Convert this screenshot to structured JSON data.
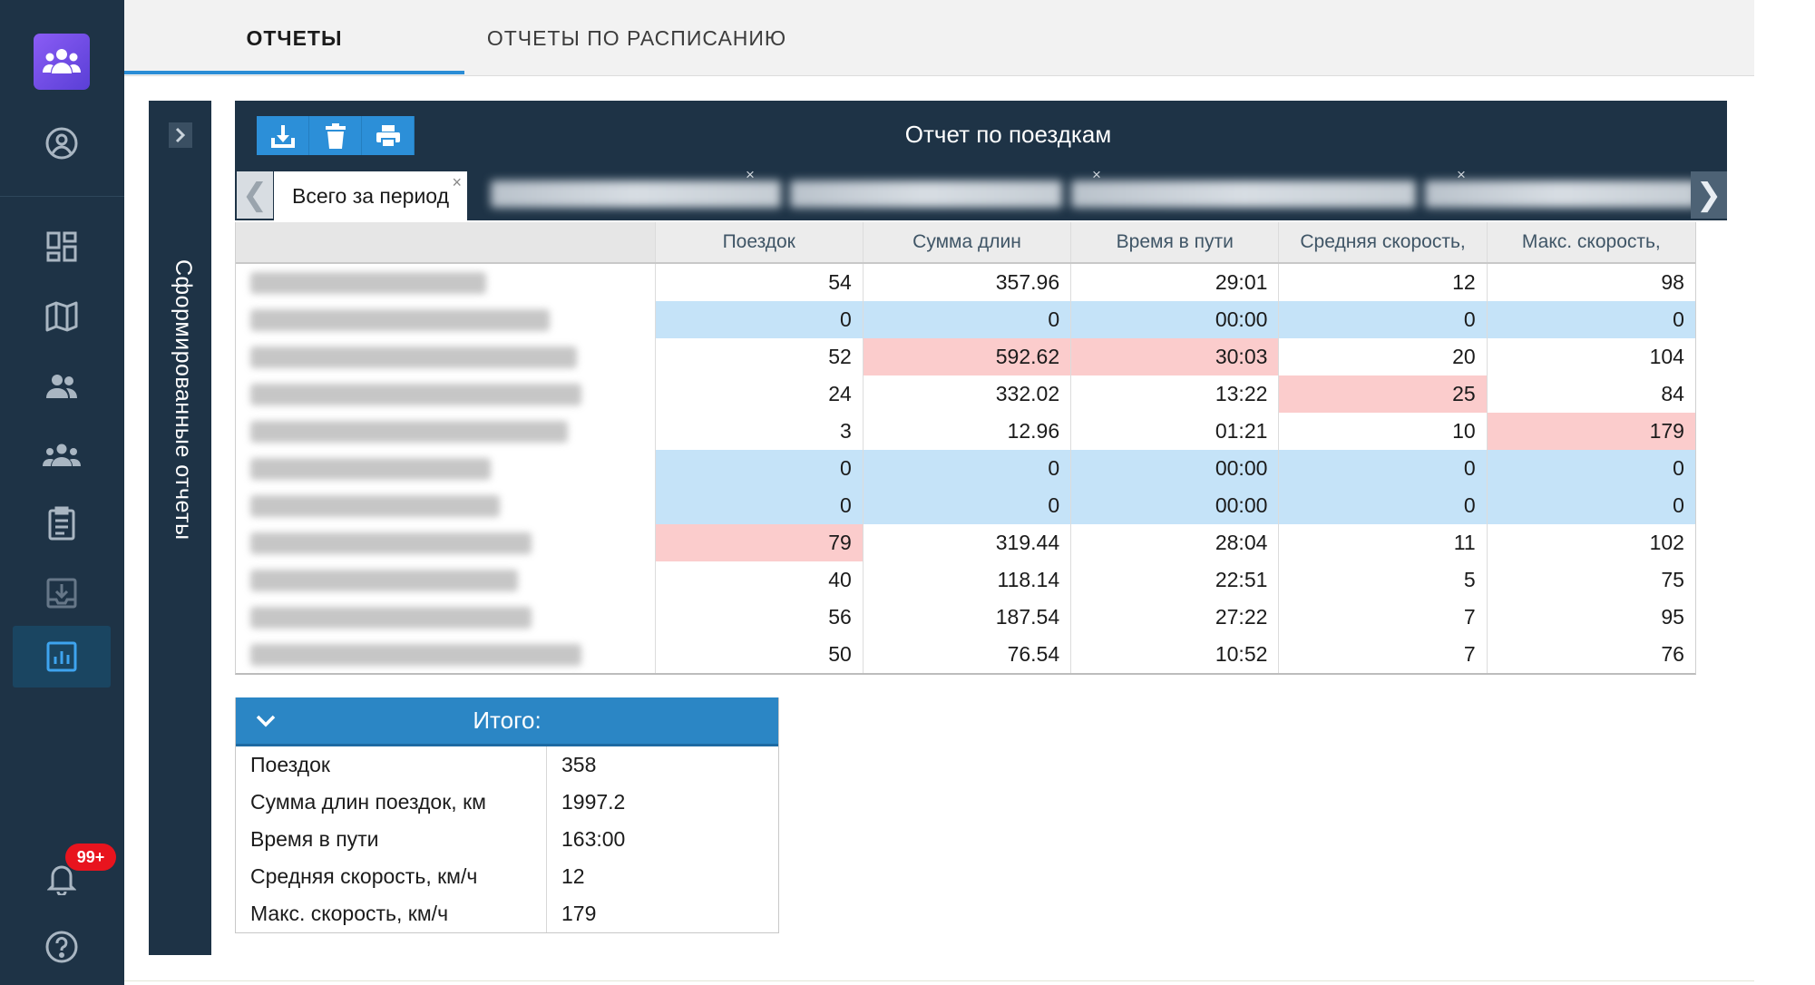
{
  "colors": {
    "sidebar_bg": "#1e3346",
    "accent_blue": "#2b8dd6",
    "highlight_blue": "#c5e3f8",
    "highlight_pink": "#fbcccc",
    "badge_red": "#e8141e"
  },
  "sidebar": {
    "logo_icon": "team-logo-icon",
    "items": [
      {
        "icon": "user-circle-icon"
      },
      {
        "icon": "dashboard-icon"
      },
      {
        "icon": "map-icon"
      },
      {
        "icon": "users-icon"
      },
      {
        "icon": "groups-icon"
      },
      {
        "icon": "clipboard-icon"
      },
      {
        "icon": "download-tray-icon"
      },
      {
        "icon": "bar-chart-icon",
        "active": true
      }
    ],
    "notifications": {
      "icon": "bell-icon",
      "badge": "99+"
    },
    "help": {
      "icon": "help-icon"
    }
  },
  "tabs": [
    {
      "label": "ОТЧЕТЫ",
      "active": true
    },
    {
      "label": "ОТЧЕТЫ ПО РАСПИСАНИЮ",
      "active": false
    }
  ],
  "reports_panel": {
    "label": "Сформированные отчеты"
  },
  "report": {
    "title": "Отчет по поездкам",
    "toolbar": [
      "download-icon",
      "trash-icon",
      "print-icon"
    ],
    "subtabs": {
      "active": "Всего за период",
      "close": "×",
      "prev": "❮",
      "next": "❯"
    },
    "columns": [
      "",
      "Поездок",
      "Сумма длин",
      "Время в пути",
      "Средняя скорость,",
      "Макс. скорость,"
    ],
    "rows": [
      {
        "trips": "54",
        "length": "357.96",
        "time": "29:01",
        "avg": "12",
        "max": "98",
        "hl": [
          "w",
          "w",
          "w",
          "w",
          "w"
        ]
      },
      {
        "trips": "0",
        "length": "0",
        "time": "00:00",
        "avg": "0",
        "max": "0",
        "hl": [
          "b",
          "b",
          "b",
          "b",
          "b"
        ]
      },
      {
        "trips": "52",
        "length": "592.62",
        "time": "30:03",
        "avg": "20",
        "max": "104",
        "hl": [
          "w",
          "p",
          "p",
          "w",
          "w"
        ]
      },
      {
        "trips": "24",
        "length": "332.02",
        "time": "13:22",
        "avg": "25",
        "max": "84",
        "hl": [
          "w",
          "w",
          "w",
          "p",
          "w"
        ]
      },
      {
        "trips": "3",
        "length": "12.96",
        "time": "01:21",
        "avg": "10",
        "max": "179",
        "hl": [
          "w",
          "w",
          "w",
          "w",
          "p"
        ]
      },
      {
        "trips": "0",
        "length": "0",
        "time": "00:00",
        "avg": "0",
        "max": "0",
        "hl": [
          "b",
          "b",
          "b",
          "b",
          "b"
        ]
      },
      {
        "trips": "0",
        "length": "0",
        "time": "00:00",
        "avg": "0",
        "max": "0",
        "hl": [
          "b",
          "b",
          "b",
          "b",
          "b"
        ]
      },
      {
        "trips": "79",
        "length": "319.44",
        "time": "28:04",
        "avg": "11",
        "max": "102",
        "hl": [
          "p",
          "w",
          "w",
          "w",
          "w"
        ]
      },
      {
        "trips": "40",
        "length": "118.14",
        "time": "22:51",
        "avg": "5",
        "max": "75",
        "hl": [
          "w",
          "w",
          "w",
          "w",
          "w"
        ]
      },
      {
        "trips": "56",
        "length": "187.54",
        "time": "27:22",
        "avg": "7",
        "max": "95",
        "hl": [
          "w",
          "w",
          "w",
          "w",
          "w"
        ]
      },
      {
        "trips": "50",
        "length": "76.54",
        "time": "10:52",
        "avg": "7",
        "max": "76",
        "hl": [
          "w",
          "w",
          "w",
          "w",
          "w"
        ]
      }
    ]
  },
  "totals": {
    "title": "Итого:",
    "rows": [
      {
        "label": "Поездок",
        "value": "358"
      },
      {
        "label": "Сумма длин поездок, км",
        "value": "1997.2"
      },
      {
        "label": "Время в пути",
        "value": "163:00"
      },
      {
        "label": "Средняя скорость, км/ч",
        "value": "12"
      },
      {
        "label": "Макс. скорость, км/ч",
        "value": "179"
      }
    ]
  }
}
